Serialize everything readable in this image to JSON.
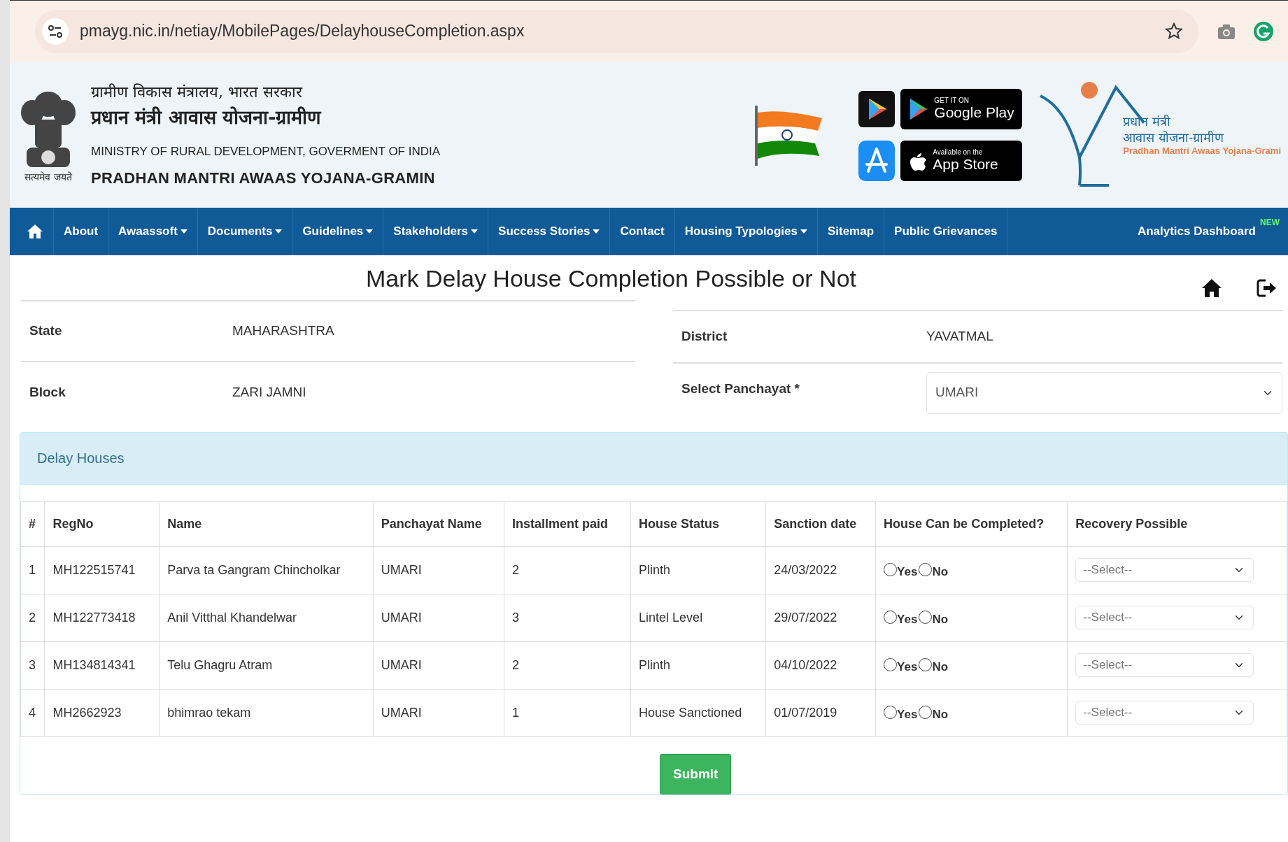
{
  "browser": {
    "url": "pmayg.nic.in/netiay/MobilePages/DelayhouseCompletion.aspx"
  },
  "header": {
    "ministry_hindi": "ग्रामीण विकास मंत्रालय, भारत सरकार",
    "scheme_hindi": "प्रधान मंत्री आवास योजना-ग्रामीण",
    "ministry": "MINISTRY OF RURAL DEVELOPMENT, GOVERMENT OF INDIA",
    "scheme": "PRADHAN MANTRI AWAAS YOJANA-GRAMIN",
    "motto": "सत्यमेव जयते",
    "google_play": {
      "small": "GET IT ON",
      "big": "Google Play"
    },
    "app_store": {
      "small": "Available on the",
      "big": "App Store"
    },
    "logo_lines": [
      "प्रधान मंत्री",
      "आवास योजना-ग्रामीण",
      "Pradhan Mantri Awaas Yojana-Grami"
    ]
  },
  "nav": [
    {
      "label": "About",
      "dropdown": false
    },
    {
      "label": "Awaassoft",
      "dropdown": true
    },
    {
      "label": "Documents",
      "dropdown": true
    },
    {
      "label": "Guidelines",
      "dropdown": true
    },
    {
      "label": "Stakeholders",
      "dropdown": true
    },
    {
      "label": "Success Stories",
      "dropdown": true
    },
    {
      "label": "Contact",
      "dropdown": false
    },
    {
      "label": "Housing Typologies",
      "dropdown": true
    },
    {
      "label": "Sitemap",
      "dropdown": false
    },
    {
      "label": "Public Grievances",
      "dropdown": false
    },
    {
      "label": "Analytics Dashboard",
      "dropdown": false,
      "badge": "NEW"
    }
  ],
  "title": "Mark Delay House Completion Possible or Not",
  "left_fields": [
    {
      "label": "State",
      "value": "MAHARASHTRA"
    },
    {
      "label": "Block",
      "value": "ZARI JAMNI"
    }
  ],
  "right_fields": [
    {
      "label": "District",
      "value": "YAVATMAL"
    }
  ],
  "panchayat": {
    "label": "Select Panchayat *",
    "value": "UMARI"
  },
  "panel": {
    "heading": "Delay Houses",
    "columns": [
      "#",
      "RegNo",
      "Name",
      "Panchayat Name",
      "Installment paid",
      "House Status",
      "Sanction date",
      "House Can be Completed?",
      "Recovery Possible"
    ],
    "rows": [
      {
        "cells": [
          "1",
          "MH122515741",
          "Parva ta Gangram Chincholkar",
          "UMARI",
          "2",
          "Plinth",
          "24/03/2022"
        ],
        "options": [
          {
            "label": "Yes",
            "checked": false
          },
          {
            "label": "No",
            "checked": false
          }
        ],
        "recovery": "--Select--"
      },
      {
        "cells": [
          "2",
          "MH122773418",
          "Anil Vitthal Khandelwar",
          "UMARI",
          "3",
          "Lintel Level",
          "29/07/2022"
        ],
        "options": [
          {
            "label": "Yes",
            "checked": false
          },
          {
            "label": "No",
            "checked": false
          }
        ],
        "recovery": "--Select--"
      },
      {
        "cells": [
          "3",
          "MH134814341",
          "Telu Ghagru Atram",
          "UMARI",
          "2",
          "Plinth",
          "04/10/2022"
        ],
        "options": [
          {
            "label": "Yes",
            "checked": false
          },
          {
            "label": "No",
            "checked": false
          }
        ],
        "recovery": "--Select--"
      },
      {
        "cells": [
          "4",
          "MH2662923",
          "bhimrao tekam",
          "UMARI",
          "1",
          "House Sanctioned",
          "01/07/2019"
        ],
        "options": [
          {
            "label": "Yes",
            "checked": false
          },
          {
            "label": "No",
            "checked": false
          }
        ],
        "recovery": "--Select--"
      }
    ],
    "submit": "Submit"
  }
}
